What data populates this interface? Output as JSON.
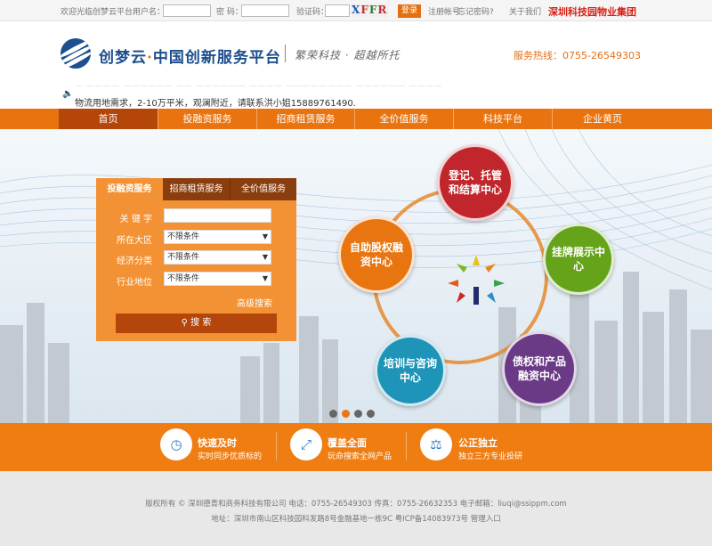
{
  "topbar": {
    "welcome": "欢迎光临创梦云平台!",
    "username_label": "用户名：",
    "password_label": "密 码：",
    "captcha_label": "验证码：",
    "captcha_text": [
      "X",
      "F",
      "F",
      "R"
    ],
    "login_button": "登录",
    "register": "注册帐号",
    "forgot": "忘记密码?",
    "about": "关于我们",
    "group": "深圳科技园物业集团"
  },
  "header": {
    "brand_name": "创梦云",
    "brand_dot": "·",
    "brand_tagline": "中国创新服务平台",
    "slogan": "繁荣科技 · 超越所托",
    "hotline": "服务热线：0755-26549303",
    "logo_icon": "swirl-logo-icon"
  },
  "notice": {
    "lines": [
      "物流用地需求，2-10万平米，观澜附近，请联系洪小姐15889761490."
    ]
  },
  "nav": {
    "items": [
      "首页",
      "投融资服务",
      "招商租赁服务",
      "全价值服务",
      "科技平台",
      "企业黄页"
    ],
    "active": 0,
    "color": "#e9740f"
  },
  "search_panel": {
    "tabs": [
      "投融资服务",
      "招商租赁服务",
      "全价值服务"
    ],
    "active_tab": 0,
    "fields": [
      {
        "label": "关 键 字",
        "value": ""
      },
      {
        "label": "所在大区",
        "value": "不限条件"
      },
      {
        "label": "经济分类",
        "value": "不限条件"
      },
      {
        "label": "行业地位",
        "value": "不限条件"
      }
    ],
    "advanced": "高级搜索",
    "search_button": "搜 索"
  },
  "services": [
    {
      "label": "登记、托管和结算中心",
      "color": "#c0262b"
    },
    {
      "label": "挂牌展示中心",
      "color": "#65a31b"
    },
    {
      "label": "债权和产品融资中心",
      "color": "#6a3a87"
    },
    {
      "label": "培训与咨询中心",
      "color": "#1d94b8"
    },
    {
      "label": "自助股权融资中心",
      "color": "#e8750f"
    }
  ],
  "carousel": {
    "count": 4,
    "active": 1
  },
  "features": [
    {
      "icon": "clock-icon",
      "title": "快速及时",
      "subtitle": "实时同步优质标的"
    },
    {
      "icon": "expand-icon",
      "title": "覆盖全面",
      "subtitle": "玩命搜索全网产品"
    },
    {
      "icon": "scale-icon",
      "title": "公正独立",
      "subtitle": "独立三方专业投研"
    }
  ],
  "footer": {
    "line1": "版权所有 © 深圳德青和商务科技有限公司 电话：0755-26549303 传真：0755-26632353 电子邮箱：liuqi@ssippm.com",
    "line2": "地址：深圳市南山区科技园科发路8号金融基地一栋9C 粤ICP备14083973号 管理入口"
  }
}
